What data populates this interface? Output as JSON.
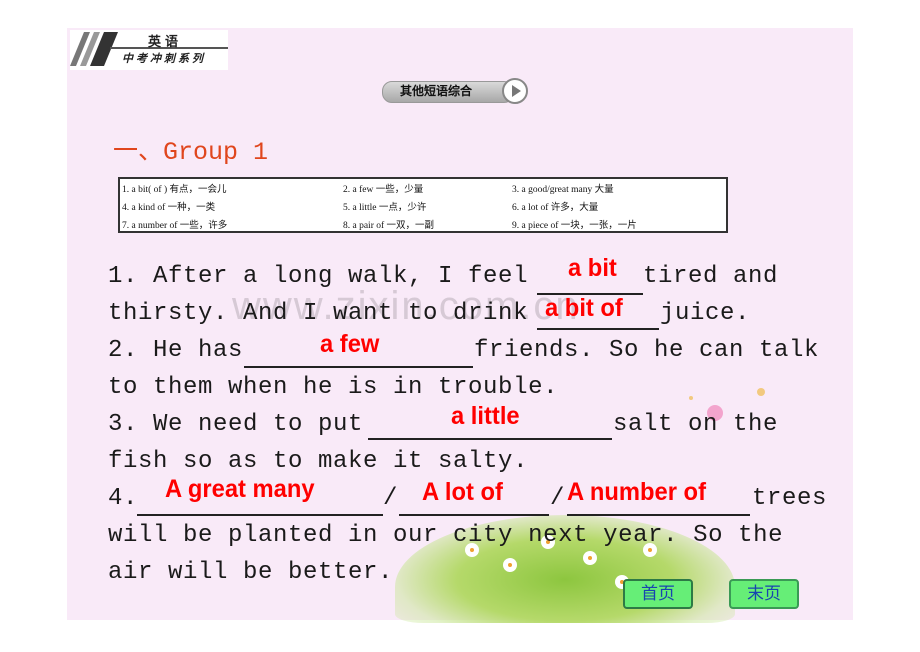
{
  "header": {
    "subject": "英语",
    "series": "中考冲刺系列"
  },
  "section_button": {
    "label": "其他短语综合",
    "icon": "play-arrow-icon"
  },
  "group_title": "一、Group 1",
  "phrase_table": [
    [
      "1. a bit( of ) 有点，一会儿",
      "2. a few 一些，少量",
      "3. a good/great many 大量"
    ],
    [
      "4. a kind of 一种，一类",
      "5. a little 一点，少许",
      "6. a lot of 许多，大量"
    ],
    [
      "7. a number of 一些，许多",
      "8. a pair of 一双，一副",
      "9. a piece of 一块，一张，一片"
    ]
  ],
  "questions": {
    "q1_line1_a": "1. After a long walk, I feel",
    "q1_line1_b": "tired and",
    "q1_line2_a": "thirsty. And I want to drink",
    "q1_line2_b": "juice.",
    "q2_line1_a": "2. He has",
    "q2_line1_b": "friends. So he can talk",
    "q2_line2": "to them when he is in trouble.",
    "q3_line1_a": "3. We need to put",
    "q3_line1_b": "salt on the",
    "q3_line2": "fish so as to make it salty.",
    "q4_line1_a": "4.",
    "q4_sep1": "/",
    "q4_sep2": "/",
    "q4_line1_b": "trees",
    "q4_line2": "will be planted in our city next year. So the",
    "q4_line3": "air will be better."
  },
  "answers": {
    "q1a": "a bit",
    "q1b": "a bit of",
    "q2": "a few",
    "q3": "a little",
    "q4a": "A great many",
    "q4b": "A lot of",
    "q4c": "A number of"
  },
  "watermark": "www.zixin.com.cn",
  "nav": {
    "first_page": "首页",
    "last_page": "末页"
  },
  "colors": {
    "answer": "#ff0000",
    "title": "#e0461d",
    "background": "#f9eaf8",
    "nav_button": "#66ee77"
  }
}
